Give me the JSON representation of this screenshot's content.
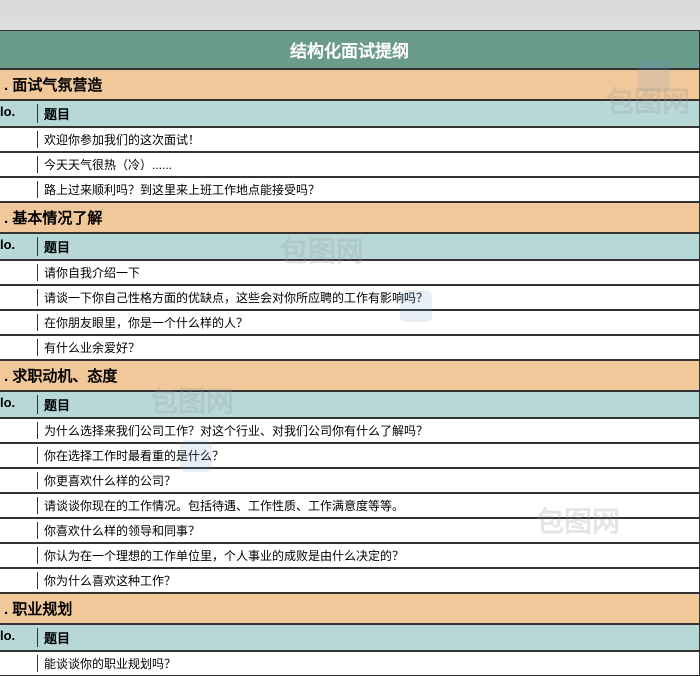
{
  "title": "结构化面试提纲",
  "watermark": "包图网",
  "sections": [
    {
      "heading": ". 面试气氛营造",
      "header_no": "lo.",
      "header_q": "题目",
      "rows": [
        "欢迎你参加我们的这次面试！",
        "今天天气很热（冷）......",
        "路上过来顺利吗？到这里来上班工作地点能接受吗？"
      ]
    },
    {
      "heading": ". 基本情况了解",
      "header_no": "lo.",
      "header_q": "题目",
      "rows": [
        "请你自我介绍一下",
        "请谈一下你自己性格方面的优缺点，这些会对你所应聘的工作有影响吗？",
        "在你朋友眼里，你是一个什么样的人？",
        "有什么业余爱好？"
      ]
    },
    {
      "heading": ". 求职动机、态度",
      "header_no": "lo.",
      "header_q": "题目",
      "rows": [
        "为什么选择来我们公司工作？对这个行业、对我们公司你有什么了解吗？",
        "你在选择工作时最看重的是什么？",
        "你更喜欢什么样的公司？",
        "请谈谈你现在的工作情况。包括待遇、工作性质、工作满意度等等。",
        "你喜欢什么样的领导和同事？",
        "你认为在一个理想的工作单位里，个人事业的成败是由什么决定的？",
        "你为什么喜欢这种工作？"
      ]
    },
    {
      "heading": ". 职业规划",
      "header_no": "lo.",
      "header_q": "题目",
      "rows": [
        "能谈谈你的职业规划吗？"
      ]
    }
  ]
}
